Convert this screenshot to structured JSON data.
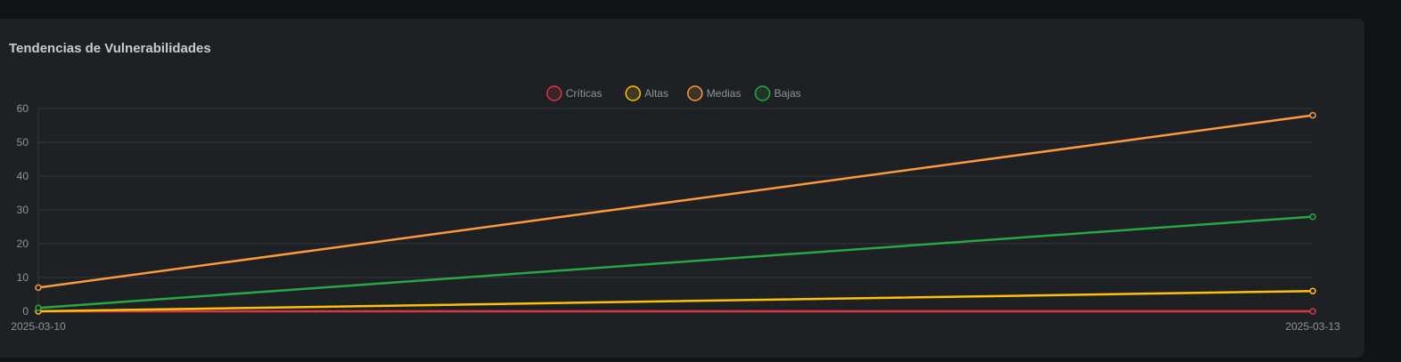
{
  "card": {
    "title": "Tendencias de Vulnerabilidades"
  },
  "chart_data": {
    "type": "line",
    "title": "Tendencias de Vulnerabilidades",
    "x": [
      "2025-03-10",
      "2025-03-13"
    ],
    "ylim": [
      0,
      60
    ],
    "yticks": [
      0,
      10,
      20,
      30,
      40,
      50,
      60
    ],
    "grid": true,
    "legend_position": "top-center",
    "series": [
      {
        "name": "Críticas",
        "color": "#dc3545",
        "values": [
          0,
          0
        ]
      },
      {
        "name": "Altas",
        "color": "#ffc107",
        "values": [
          0,
          6
        ]
      },
      {
        "name": "Medias",
        "color": "#fd9a3c",
        "values": [
          7,
          58
        ]
      },
      {
        "name": "Bajas",
        "color": "#28a745",
        "values": [
          1,
          28
        ]
      }
    ]
  }
}
